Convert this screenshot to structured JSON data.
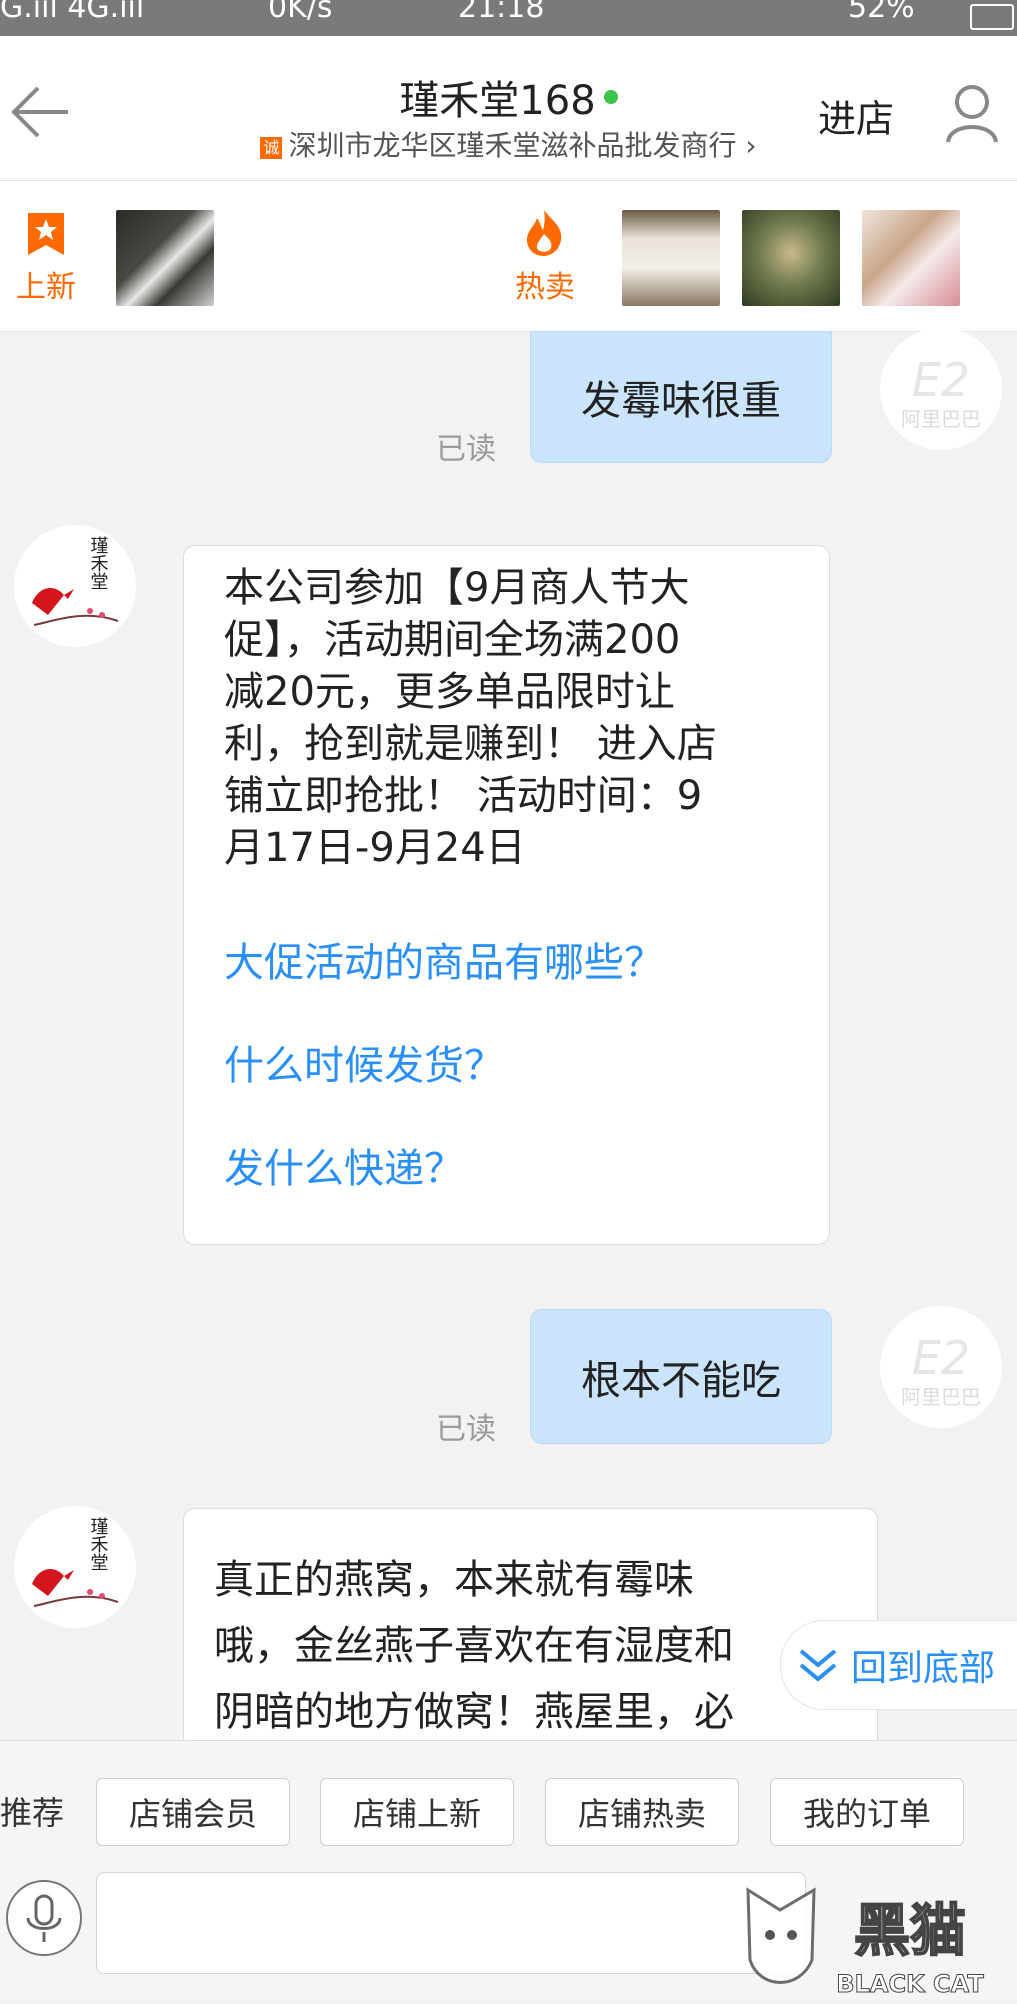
{
  "status_bar": {
    "signal": "G.ııl 4G.ııl",
    "speed": "0K/s",
    "time": "21:18",
    "battery": "52%"
  },
  "header": {
    "title": "瑾禾堂168",
    "badge": "诚",
    "subtitle": "深圳市龙华区瑾禾堂滋补品批发商行",
    "enter_shop": "进店"
  },
  "promo": {
    "new_label": "上新",
    "hot_label": "热卖"
  },
  "messages": {
    "out1": {
      "text": "发霉味很重",
      "status": "已读"
    },
    "in1": {
      "lines": [
        "本公司参加【9月商人节大",
        "促】，活动期间全场满200",
        "减20元，更多单品限时让",
        "利，抢到就是赚到！ 进入店",
        "铺立即抢批！ 活动时间：9",
        "月17日-9月24日"
      ],
      "questions": [
        "大促活动的商品有哪些？",
        "什么时候发货？",
        "发什么快递？"
      ]
    },
    "out2": {
      "text": "根本不能吃",
      "status": "已读"
    },
    "in2": {
      "lines": [
        "真正的燕窝，本来就有霉味",
        "哦，金丝燕子喜欢在有湿度和",
        "阴暗的地方做窝！燕屋里，必"
      ]
    }
  },
  "avatar_text": "瑾禾堂",
  "ali_avatar_text": "阿里巴巴",
  "back_to_bottom": "回到底部",
  "quick_bar": {
    "recommend_label": "推荐",
    "chips": [
      "店铺会员",
      "店铺上新",
      "店铺热卖",
      "我的订单"
    ]
  },
  "watermark": {
    "cn": "黑猫",
    "en": "BLACK CAT"
  }
}
